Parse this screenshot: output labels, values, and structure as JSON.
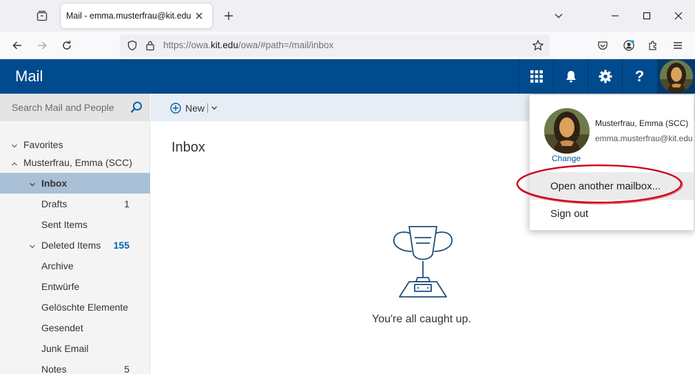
{
  "browser": {
    "tab_title": "Mail - emma.musterfrau@kit.edu",
    "url_prefix": "https://owa.",
    "url_domain": "kit.edu",
    "url_path": "/owa/#path=/mail/inbox",
    "icons": [
      "tab-list-icon",
      "close-icon",
      "plus-icon",
      "chevron-down-icon",
      "minimize-icon",
      "maximize-icon",
      "close-icon",
      "back-arrow-icon",
      "forward-arrow-icon",
      "reload-icon",
      "shield-icon",
      "lock-icon",
      "star-icon",
      "pocket-icon",
      "account-icon",
      "extensions-icon",
      "menu-icon"
    ]
  },
  "owa": {
    "app_title": "Mail",
    "header_buttons": [
      "app-launcher-icon",
      "bell-icon",
      "gear-icon",
      "help-icon"
    ],
    "help_label": "?",
    "header_color": "#004b8d"
  },
  "sidebar": {
    "search_placeholder": "Search Mail and People",
    "favorites_label": "Favorites",
    "account_label": "Musterfrau, Emma (SCC)",
    "folders": [
      {
        "label": "Inbox",
        "count": ""
      },
      {
        "label": "Drafts",
        "count": "1"
      },
      {
        "label": "Sent Items",
        "count": ""
      },
      {
        "label": "Deleted Items",
        "count": "155"
      },
      {
        "label": "Archive",
        "count": ""
      },
      {
        "label": "Entwürfe",
        "count": ""
      },
      {
        "label": "Gelöschte Elemente",
        "count": ""
      },
      {
        "label": "Gesendet",
        "count": ""
      },
      {
        "label": "Junk Email",
        "count": ""
      },
      {
        "label": "Notes",
        "count": "5"
      }
    ]
  },
  "commandbar": {
    "new_label": "New"
  },
  "main": {
    "folder_title": "Inbox",
    "empty_message": "You're all caught up."
  },
  "account_menu": {
    "name": "Musterfrau, Emma (SCC)",
    "email": "emma.musterfrau@kit.edu",
    "change_label": "Change",
    "items": [
      "Open another mailbox...",
      "Sign out"
    ],
    "highlight_color": "#d0021b"
  }
}
